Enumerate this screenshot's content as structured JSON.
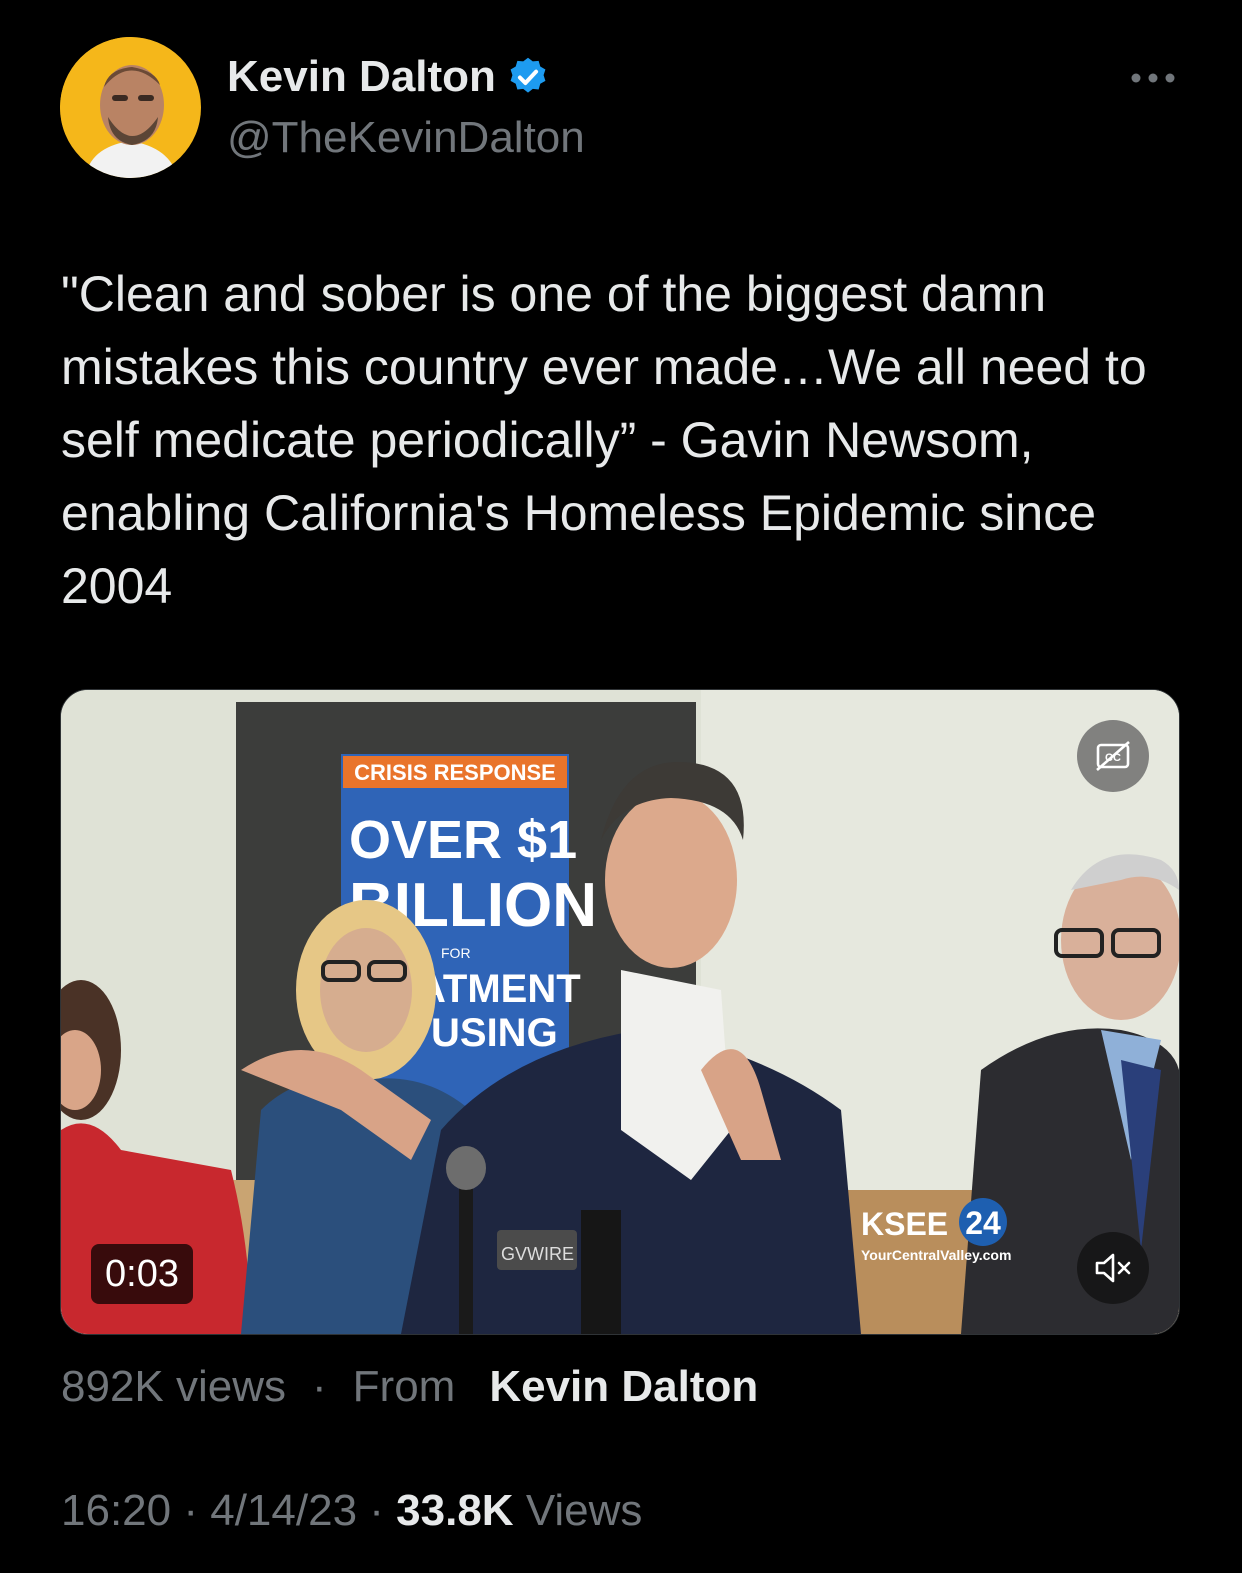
{
  "author": {
    "display_name": "Kevin Dalton",
    "handle": "@TheKevinDalton",
    "verified_icon": "verified-badge-icon",
    "avatar_bg": "#f5b71a"
  },
  "more_icon": "more-horizontal-icon",
  "tweet": {
    "text": "\"Clean and sober is one of the biggest damn mistakes this country ever made…We all need to self medicate periodically” - Gavin Newsom, enabling California's Homeless Epidemic since 2004"
  },
  "video": {
    "duration": "0:03",
    "cc_icon": "captions-off-icon",
    "mute_icon": "volume-muted-icon",
    "sign_label": "CRISIS RESPONSE",
    "sign_line1": "OVER $1",
    "sign_line2": "BILLION",
    "sign_for": "FOR",
    "sign_line3": "ATMENT",
    "sign_line4": "USING",
    "mic_label": "GVWIRE",
    "station_logo": "KSEE",
    "station_number": "24",
    "station_site": "YourCentralValley.com"
  },
  "video_meta": {
    "views": "892K views",
    "separator": "·",
    "from_label": "From",
    "from_name": "Kevin Dalton"
  },
  "timestamp": {
    "time": "16:20",
    "sep": "·",
    "date": "4/14/23",
    "views_count": "33.8K",
    "views_label": "Views"
  },
  "colors": {
    "background": "#000000",
    "text_primary": "#e7e9ea",
    "text_secondary": "#71767b",
    "verified_blue": "#1d9bf0"
  }
}
